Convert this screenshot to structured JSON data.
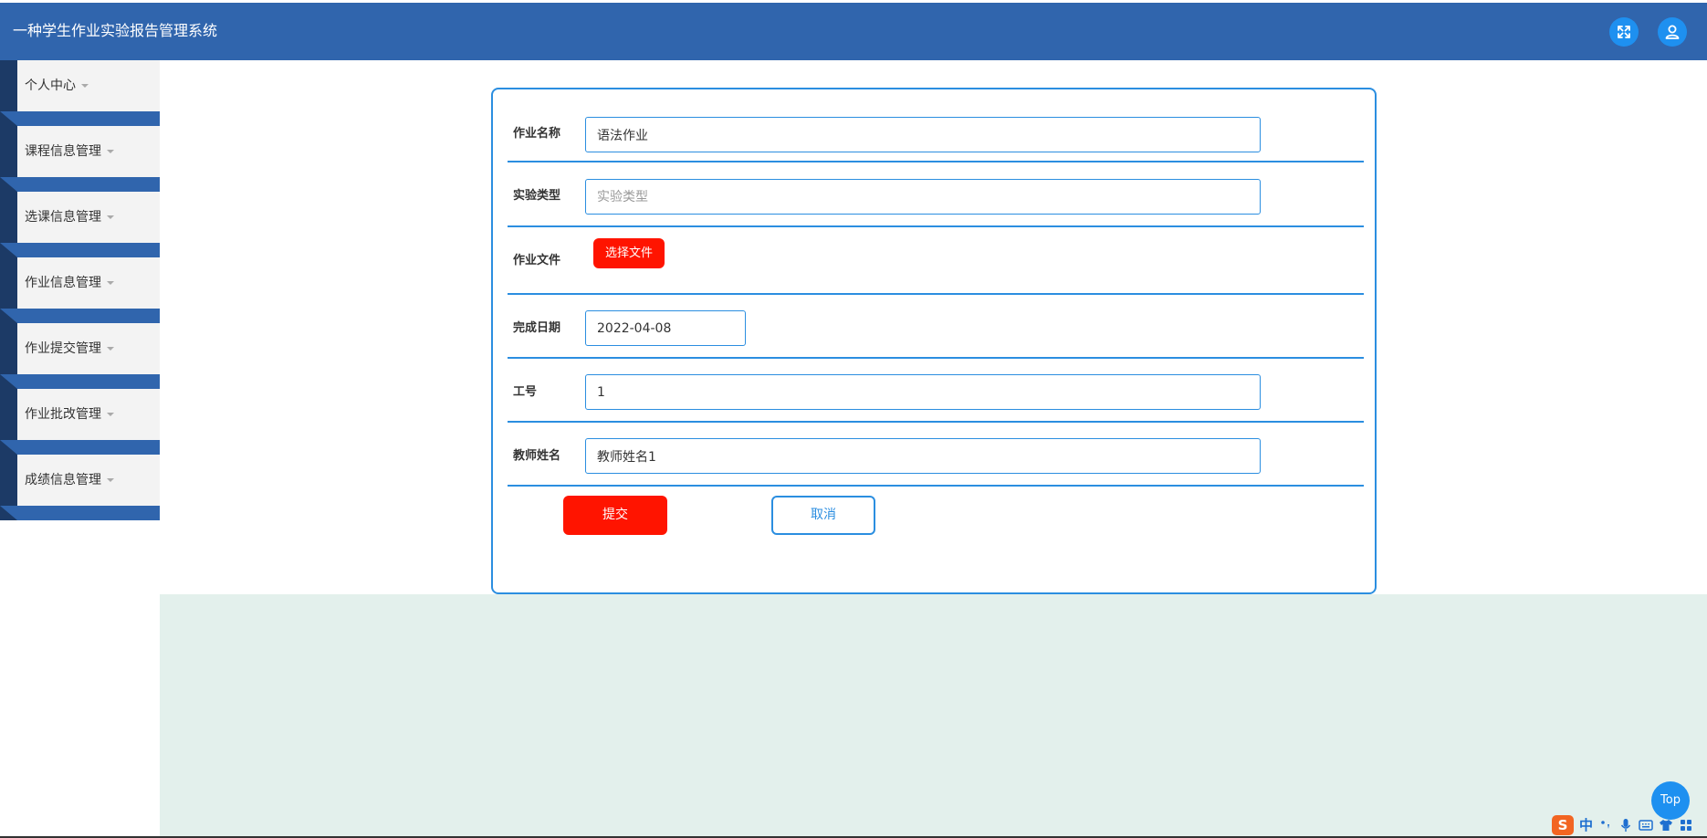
{
  "app": {
    "title": "一种学生作业实验报告管理系统"
  },
  "sidebar": {
    "items": [
      {
        "label": "个人中心"
      },
      {
        "label": "课程信息管理"
      },
      {
        "label": "选课信息管理"
      },
      {
        "label": "作业信息管理"
      },
      {
        "label": "作业提交管理"
      },
      {
        "label": "作业批改管理"
      },
      {
        "label": "成绩信息管理"
      }
    ]
  },
  "form": {
    "name_label": "作业名称",
    "name_value": "语法作业",
    "type_label": "实验类型",
    "type_placeholder": "实验类型",
    "file_label": "作业文件",
    "file_button": "选择文件",
    "date_label": "完成日期",
    "date_value": "2022-04-08",
    "workno_label": "工号",
    "workno_value": "1",
    "teacher_label": "教师姓名",
    "teacher_value": "教师姓名1",
    "submit_label": "提交",
    "cancel_label": "取消"
  },
  "float": {
    "top_label": "Top"
  },
  "ime": {
    "logo": "S",
    "lang": "中"
  },
  "colors": {
    "header": "#3065ad",
    "accent": "#2b8ee0",
    "danger": "#ff1400",
    "sidebar_dark": "#1c3a66"
  }
}
